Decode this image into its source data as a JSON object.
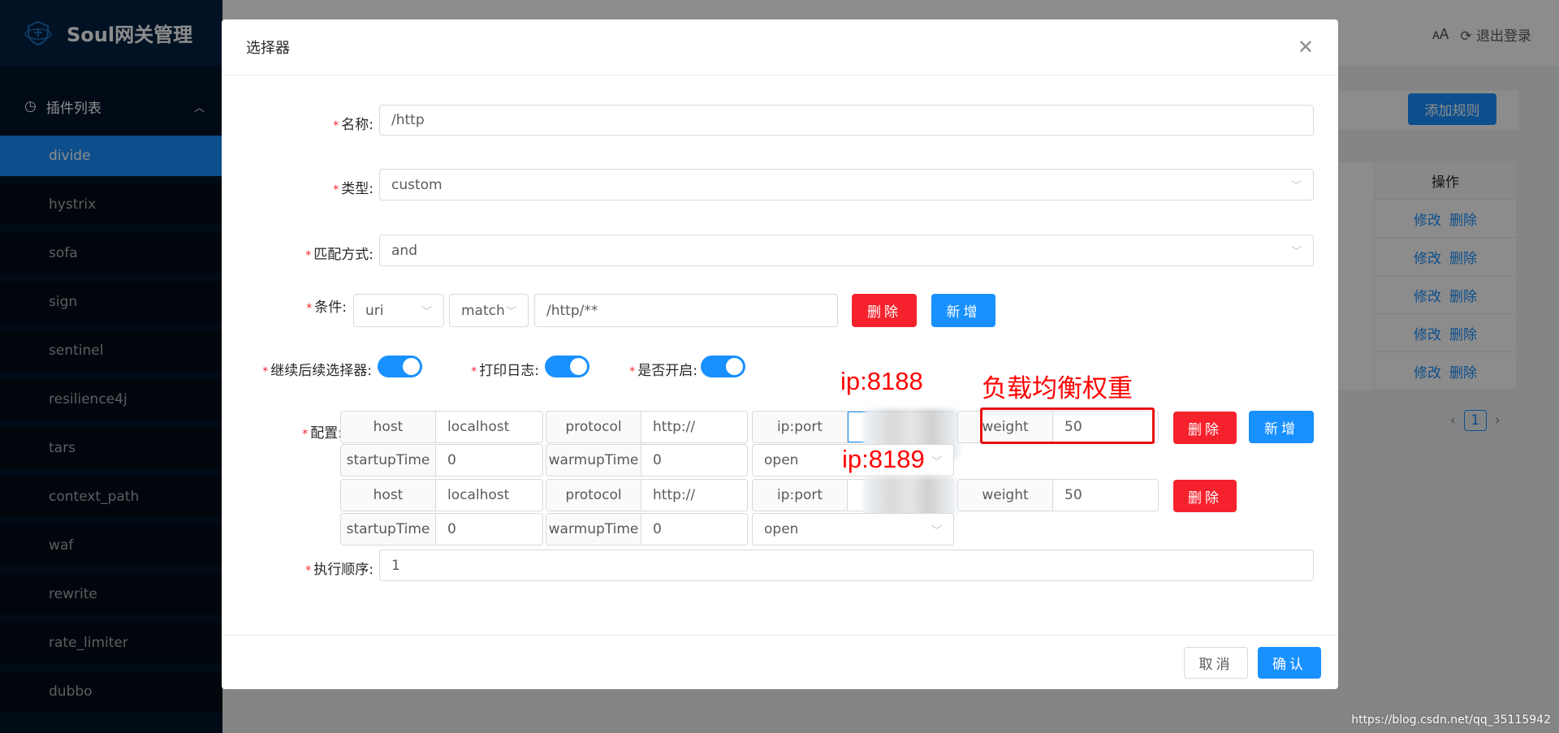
{
  "app": {
    "title": "Soul网关管理"
  },
  "sidebar": {
    "group": "插件列表",
    "items": [
      "divide",
      "hystrix",
      "sofa",
      "sign",
      "sentinel",
      "resilience4j",
      "tars",
      "context_path",
      "waf",
      "rewrite",
      "rate_limiter",
      "dubbo"
    ],
    "active": "divide"
  },
  "header": {
    "logout": "退出登录"
  },
  "background": {
    "add_rule": "添加规则",
    "table_header": "操作",
    "rows": [
      {
        "edit": "修改",
        "delete": "删除"
      },
      {
        "edit": "修改",
        "delete": "删除"
      },
      {
        "edit": "修改",
        "delete": "删除"
      },
      {
        "edit": "修改",
        "delete": "删除"
      },
      {
        "edit": "修改",
        "delete": "删除"
      }
    ],
    "page": "1"
  },
  "modal": {
    "title": "选择器",
    "name": {
      "label": "名称:",
      "value": "/http"
    },
    "type": {
      "label": "类型:",
      "value": "custom"
    },
    "match_mode": {
      "label": "匹配方式:",
      "value": "and"
    },
    "condition": {
      "label": "条件:",
      "param": "uri",
      "operator": "match",
      "value": "/http/**",
      "delete": "删除",
      "add": "新增"
    },
    "switches": [
      {
        "label": "继续后续选择器:",
        "on": true
      },
      {
        "label": "打印日志:",
        "on": true
      },
      {
        "label": "是否开启:",
        "on": true
      }
    ],
    "config": {
      "label": "配置:",
      "upstreams": [
        {
          "host_label": "host",
          "host": "localhost",
          "protocol_label": "protocol",
          "protocol": "http://",
          "ip_label": "ip:port",
          "weight_label": "weight",
          "weight": "50",
          "startup_label": "startupTime",
          "startup": "0",
          "warmup_label": "warmupTime",
          "warmup": "0",
          "status": "open"
        },
        {
          "host_label": "host",
          "host": "localhost",
          "protocol_label": "protocol",
          "protocol": "http://",
          "ip_label": "ip:port",
          "weight_label": "weight",
          "weight": "50",
          "startup_label": "startupTime",
          "startup": "0",
          "warmup_label": "warmupTime",
          "warmup": "0",
          "status": "open"
        }
      ],
      "delete": "删除",
      "add": "新增"
    },
    "order": {
      "label": "执行顺序:",
      "value": "1"
    },
    "cancel": "取消",
    "ok": "确认"
  },
  "annotations": {
    "ip1": "ip:8188",
    "ip2": "ip:8189",
    "weight_note": "负载均衡权重"
  },
  "watermark": "https://blog.csdn.net/qq_35115942",
  "colors": {
    "primary": "#1890ff",
    "danger": "#f5222d",
    "sidebar": "#001529",
    "annotation": "#ff0000"
  }
}
